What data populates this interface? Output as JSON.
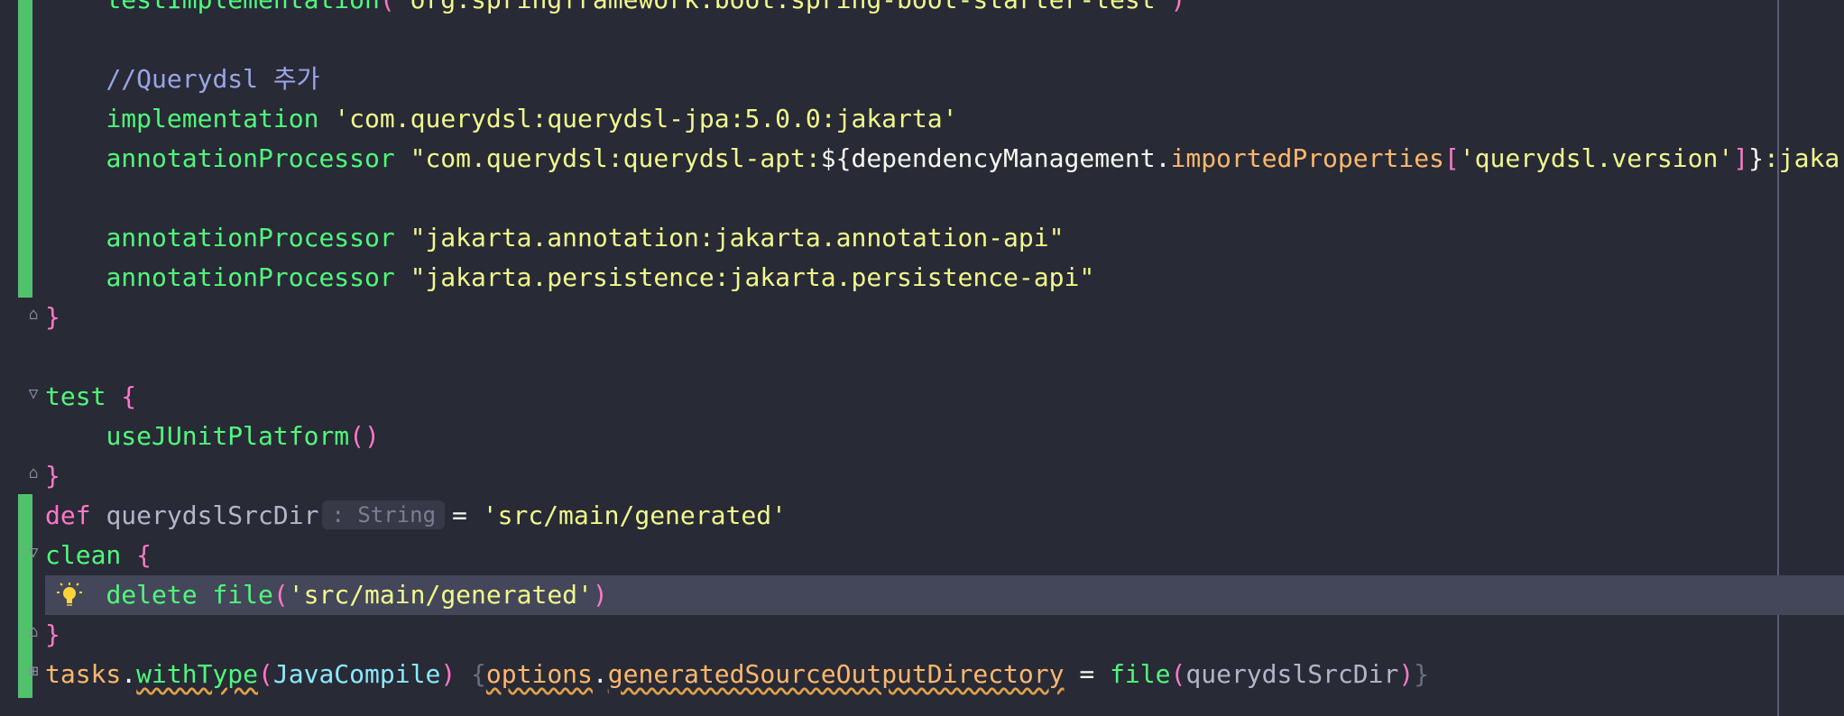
{
  "editor": {
    "lines": {
      "l0": {
        "fn": "testImplementation",
        "p1": "(",
        "str": "'org.springframework.boot:spring-boot-starter-test'",
        "p2": ")"
      },
      "l1": {
        "comment": "//Querydsl 추가"
      },
      "l2": {
        "fn": "implementation",
        "str": "'com.querydsl:querydsl-jpa:5.0.0:jakarta'"
      },
      "l3": {
        "fn": "annotationProcessor",
        "str1": "\"com.querydsl:querydsl-apt:",
        "interp_open": "${",
        "ref": "dependencyManagement",
        "dot": ".",
        "prop": "importedProperties",
        "br_open": "[",
        "key": "'querydsl.version'",
        "br_close": "]",
        "interp_close": "}",
        "str2": ":jakarta\""
      },
      "l4": {
        "fn": "annotationProcessor",
        "str": "\"jakarta.annotation:jakarta.annotation-api\""
      },
      "l5": {
        "fn": "annotationProcessor",
        "str": "\"jakarta.persistence:jakarta.persistence-api\""
      },
      "l6": {
        "brace": "}"
      },
      "l7": {
        "fn": "test",
        "brace": "{"
      },
      "l8": {
        "fn": "useJUnitPlatform",
        "parens": "()"
      },
      "l9": {
        "brace": "}"
      },
      "l10": {
        "kw": "def",
        "name": "querydslSrcDir",
        "hint": ": String",
        "eq": "=",
        "str": "'src/main/generated'"
      },
      "l11": {
        "fn": "clean",
        "brace": "{"
      },
      "l12": {
        "fn1": "delete",
        "fn2": "file",
        "p1": "(",
        "str": "'src/main/generated'",
        "p2": ")"
      },
      "l13": {
        "brace": "}"
      },
      "l14": {
        "obj": "tasks",
        "dot": ".",
        "fn": "withType",
        "p1": "(",
        "cls": "JavaCompile",
        "p2": ")",
        "b1": "{",
        "prop1": "options",
        "dot2": ".",
        "prop2": "generatedSourceOutputDirectory",
        "eq": "=",
        "fn2": "file",
        "p3": "(",
        "arg": "querydslSrcDir",
        "p4": ")",
        "b2": "}"
      }
    }
  },
  "icons": {
    "bulb": "lightbulb-icon",
    "fold": "fold-icon"
  },
  "colors": {
    "background": "#282a36",
    "current_line": "#44475a",
    "change_bar": "#50c26a"
  }
}
